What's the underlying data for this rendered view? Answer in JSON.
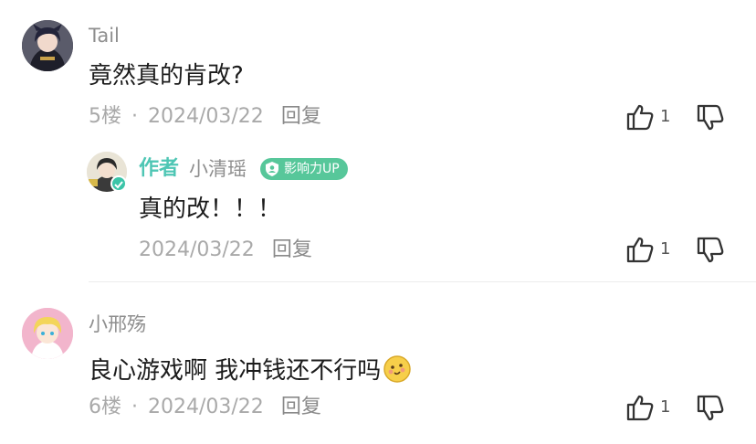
{
  "comments": [
    {
      "username": "Tail",
      "content": "竟然真的肯改?",
      "floor": "5楼",
      "sep": "·",
      "date": "2024/03/22",
      "reply_label": "回复",
      "like_count": "1",
      "reply": {
        "author_tag": "作者",
        "username": "小清瑶",
        "badge": "影响力UP",
        "content": "真的改！！！",
        "date": "2024/03/22",
        "reply_label": "回复",
        "like_count": "1"
      }
    },
    {
      "username": "小邢殇",
      "content": "良心游戏啊 我冲钱还不行吗",
      "emoji": "smiling-face-emoji",
      "floor": "6楼",
      "sep": "·",
      "date": "2024/03/22",
      "reply_label": "回复",
      "like_count": "1"
    }
  ],
  "icons": {
    "like": "thumbs-up-icon",
    "dislike": "thumbs-down-icon",
    "verified": "verified-check-icon"
  },
  "colors": {
    "author_tag": "#4ec6b4",
    "badge_bg": "#57c79a",
    "verified": "#3bc4a8"
  }
}
